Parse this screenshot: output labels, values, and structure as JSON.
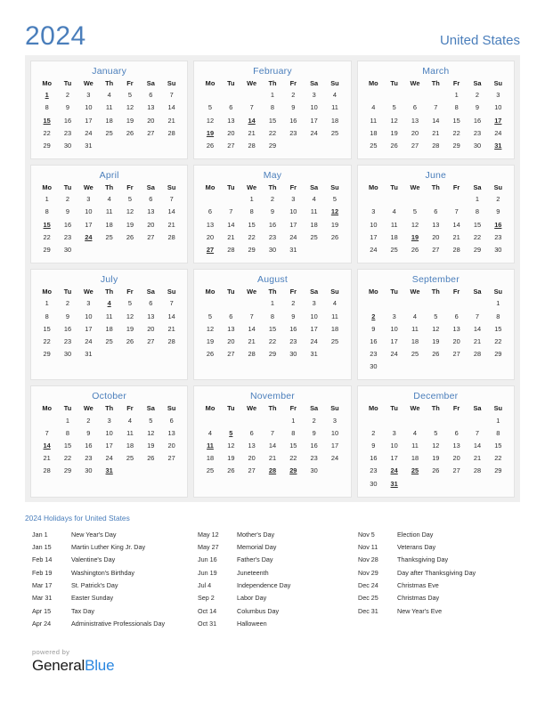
{
  "header": {
    "year": "2024",
    "country": "United States"
  },
  "weekday_headers": [
    "Mo",
    "Tu",
    "We",
    "Th",
    "Fr",
    "Sa",
    "Su"
  ],
  "colors": {
    "accent_blue": "#4a7ebb",
    "holiday_red": "#e00000",
    "panel_gray": "#efefef",
    "card_white": "#fcfcfc",
    "brand_blue": "#2a87e0"
  },
  "months": [
    {
      "name": "January",
      "lead_blanks": 0,
      "days": 31,
      "holidays": [
        1,
        15
      ]
    },
    {
      "name": "February",
      "lead_blanks": 3,
      "days": 29,
      "holidays": [
        14,
        19
      ]
    },
    {
      "name": "March",
      "lead_blanks": 4,
      "days": 31,
      "holidays": [
        17,
        31
      ]
    },
    {
      "name": "April",
      "lead_blanks": 0,
      "days": 30,
      "holidays": [
        15,
        24
      ]
    },
    {
      "name": "May",
      "lead_blanks": 2,
      "days": 31,
      "holidays": [
        12,
        27
      ]
    },
    {
      "name": "June",
      "lead_blanks": 5,
      "days": 30,
      "holidays": [
        16,
        19
      ]
    },
    {
      "name": "July",
      "lead_blanks": 0,
      "days": 31,
      "holidays": [
        4
      ]
    },
    {
      "name": "August",
      "lead_blanks": 3,
      "days": 31,
      "holidays": []
    },
    {
      "name": "September",
      "lead_blanks": 6,
      "days": 30,
      "holidays": [
        2
      ]
    },
    {
      "name": "October",
      "lead_blanks": 1,
      "days": 31,
      "holidays": [
        14,
        31
      ]
    },
    {
      "name": "November",
      "lead_blanks": 4,
      "days": 30,
      "holidays": [
        5,
        11,
        28,
        29
      ]
    },
    {
      "name": "December",
      "lead_blanks": 6,
      "days": 31,
      "holidays": [
        24,
        25,
        31
      ]
    }
  ],
  "holidays_section": {
    "heading": "2024 Holidays for United States",
    "columns": [
      [
        {
          "date": "Jan 1",
          "name": "New Year's Day"
        },
        {
          "date": "Jan 15",
          "name": "Martin Luther King Jr. Day"
        },
        {
          "date": "Feb 14",
          "name": "Valentine's Day"
        },
        {
          "date": "Feb 19",
          "name": "Washington's Birthday"
        },
        {
          "date": "Mar 17",
          "name": "St. Patrick's Day"
        },
        {
          "date": "Mar 31",
          "name": "Easter Sunday"
        },
        {
          "date": "Apr 15",
          "name": "Tax Day"
        },
        {
          "date": "Apr 24",
          "name": "Administrative Professionals Day"
        }
      ],
      [
        {
          "date": "May 12",
          "name": "Mother's Day"
        },
        {
          "date": "May 27",
          "name": "Memorial Day"
        },
        {
          "date": "Jun 16",
          "name": "Father's Day"
        },
        {
          "date": "Jun 19",
          "name": "Juneteenth"
        },
        {
          "date": "Jul 4",
          "name": "Independence Day"
        },
        {
          "date": "Sep 2",
          "name": "Labor Day"
        },
        {
          "date": "Oct 14",
          "name": "Columbus Day"
        },
        {
          "date": "Oct 31",
          "name": "Halloween"
        }
      ],
      [
        {
          "date": "Nov 5",
          "name": "Election Day"
        },
        {
          "date": "Nov 11",
          "name": "Veterans Day"
        },
        {
          "date": "Nov 28",
          "name": "Thanksgiving Day"
        },
        {
          "date": "Nov 29",
          "name": "Day after Thanksgiving Day"
        },
        {
          "date": "Dec 24",
          "name": "Christmas Eve"
        },
        {
          "date": "Dec 25",
          "name": "Christmas Day"
        },
        {
          "date": "Dec 31",
          "name": "New Year's Eve"
        }
      ]
    ]
  },
  "footer": {
    "powered_by": "powered by",
    "brand_first": "General",
    "brand_second": "Blue"
  }
}
